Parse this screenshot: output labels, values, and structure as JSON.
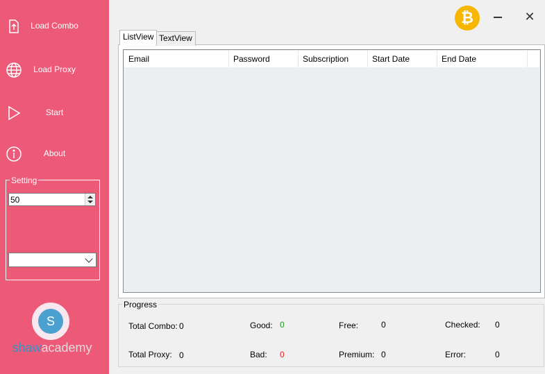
{
  "sidebar": {
    "items": [
      {
        "label": "Load Combo",
        "icon": "file-upload-icon"
      },
      {
        "label": "Load Proxy",
        "icon": "globe-icon"
      },
      {
        "label": "Start",
        "icon": "play-icon"
      },
      {
        "label": "About",
        "icon": "info-icon"
      }
    ],
    "setting": {
      "legend": "Setting",
      "threads_value": "50",
      "dropdown_value": ""
    },
    "logo": {
      "letter": "S",
      "text_part1": "shaw",
      "text_part2": "academy"
    }
  },
  "titlebar": {
    "bitcoin_symbol": "₿",
    "close_symbol": "✕"
  },
  "tabs": [
    {
      "label": "ListView",
      "active": true
    },
    {
      "label": "TextView",
      "active": false
    }
  ],
  "listview": {
    "columns": [
      "Email",
      "Password",
      "Subscription",
      "Start Date",
      "End Date"
    ],
    "rows": []
  },
  "progress": {
    "legend": "Progress",
    "total_combo_label": "Total Combo:",
    "total_combo_value": "0",
    "total_proxy_label": "Total Proxy:",
    "total_proxy_value": "0",
    "good_label": "Good:",
    "good_value": "0",
    "bad_label": "Bad:",
    "bad_value": "0",
    "free_label": "Free:",
    "free_value": "0",
    "premium_label": "Premium:",
    "premium_value": "0",
    "checked_label": "Checked:",
    "checked_value": "0",
    "error_label": "Error:",
    "error_value": "0"
  },
  "colors": {
    "sidebar": "#ec5a78",
    "bitcoin": "#f7b600",
    "good": "#1a9a1a",
    "bad": "#e02020"
  }
}
